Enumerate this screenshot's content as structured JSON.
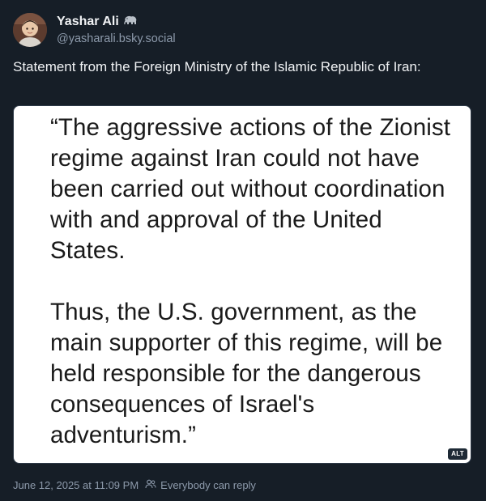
{
  "author": {
    "display_name": "Yashar Ali",
    "name_emoji": "elephant-icon",
    "handle": "@yasharali.bsky.social"
  },
  "post": {
    "text": "Statement from the Foreign Ministry of the Islamic Republic of Iran:",
    "image": {
      "paragraphs": [
        "“The aggressive actions of the Zionist regime against Iran could not have been carried out without coordination with and approval of the United States.",
        "Thus, the U.S. government, as the main supporter of this regime, will be held responsible for the dangerous consequences of Israel's adventurism.”"
      ],
      "alt_badge": "ALT"
    },
    "timestamp": "June 12, 2025 at 11:09 PM",
    "reply_setting": "Everybody can reply"
  },
  "colors": {
    "background": "#161e27",
    "text_primary": "#f1f3f5",
    "text_secondary": "#8d9aab",
    "image_background": "#ffffff"
  }
}
